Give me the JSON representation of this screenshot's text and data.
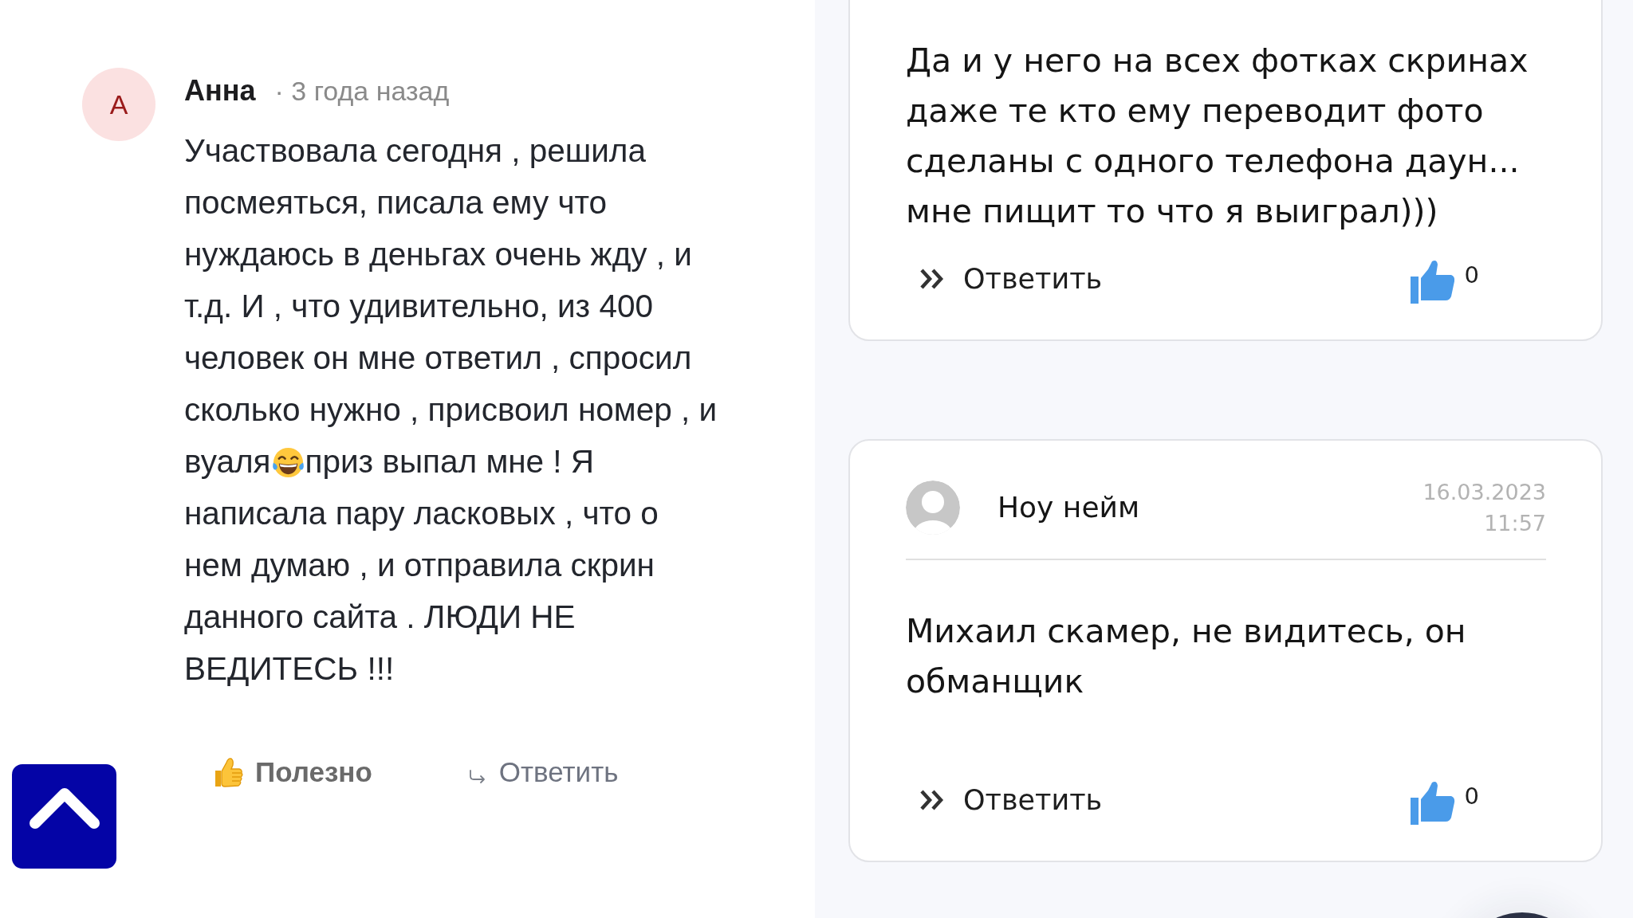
{
  "comment": {
    "avatar_letter": "А",
    "author": "Анна",
    "time": "· 3 года назад",
    "body": [
      {
        "kind": "text",
        "text": "Участвовала сегодня , решила посмеяться, писала ему что нуждаюсь в деньгах очень жду , и т.д. И , что удивительно, из 400 человек он мне ответил , спросил сколько нужно , присвоил номер , и вуаля"
      },
      {
        "kind": "emoji"
      },
      {
        "kind": "text",
        "text": "приз выпал мне ! Я написала пару ласковых , что о нем думаю , и отправила скрин данного сайта . ЛЮДИ НЕ ВЕДИТЕСЬ !!!"
      }
    ],
    "actions": [
      {
        "kind": "helpful",
        "label": "Полезно"
      },
      {
        "kind": "reply",
        "label": "Ответить"
      }
    ]
  },
  "replies": [
    {
      "text": "Да и у него на всех фотках скринах даже те кто ему переводит фото сделаны с одного телефона даун... мне пищит то что я выиграл)))",
      "reply_label": "Ответить",
      "likes": "0"
    },
    {
      "author": "Ноу нейм",
      "date": "16.03.2023",
      "time": "11:57",
      "text": "Михаил скамер, не видитесь, он обманщик",
      "reply_label": "Ответить",
      "likes": "0"
    }
  ]
}
